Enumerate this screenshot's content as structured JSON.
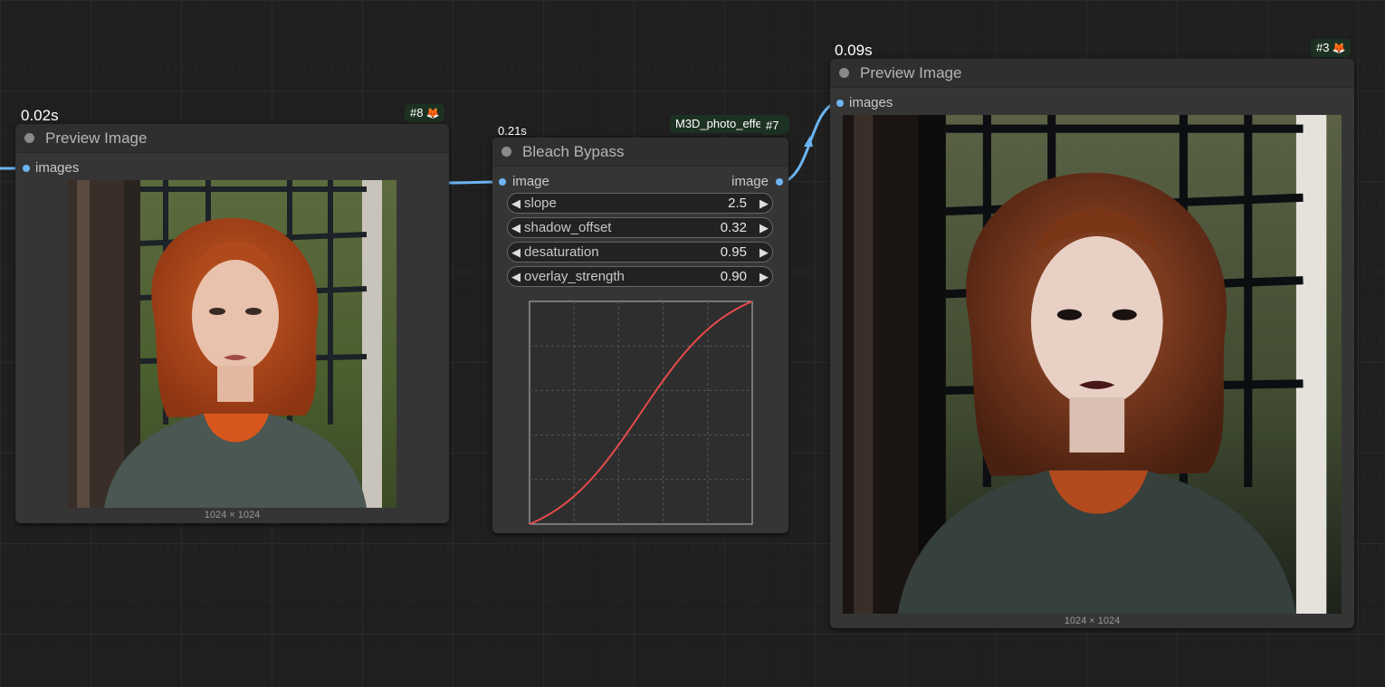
{
  "nodes": {
    "preview_left": {
      "timing": "0.02s",
      "badge_id": "#8",
      "badge_icon": "fox-icon",
      "title": "Preview Image",
      "input_label": "images",
      "image_size": "1024 × 1024"
    },
    "bleach": {
      "timing": "0.21s",
      "badge_pack": "M3D_photo_effe",
      "badge_id": "#7",
      "title": "Bleach Bypass",
      "input_label": "image",
      "output_label": "image",
      "widgets": [
        {
          "name": "slope",
          "value": "2.5"
        },
        {
          "name": "shadow_offset",
          "value": "0.32"
        },
        {
          "name": "desaturation",
          "value": "0.95"
        },
        {
          "name": "overlay_strength",
          "value": "0.90"
        }
      ]
    },
    "preview_right": {
      "timing": "0.09s",
      "badge_id": "#3",
      "badge_icon": "fox-icon",
      "title": "Preview Image",
      "input_label": "images",
      "image_size": "1024 × 1024"
    }
  },
  "colors": {
    "canvas": "#202020",
    "node_body": "#353535",
    "wire": "#6cb5f2",
    "curve": "#e64a4a",
    "badge": "#1c3122"
  },
  "curve_data": {
    "type": "line",
    "slope": 2.5,
    "x_range": [
      0,
      1
    ],
    "y_range": [
      0,
      1
    ],
    "grid": true
  }
}
